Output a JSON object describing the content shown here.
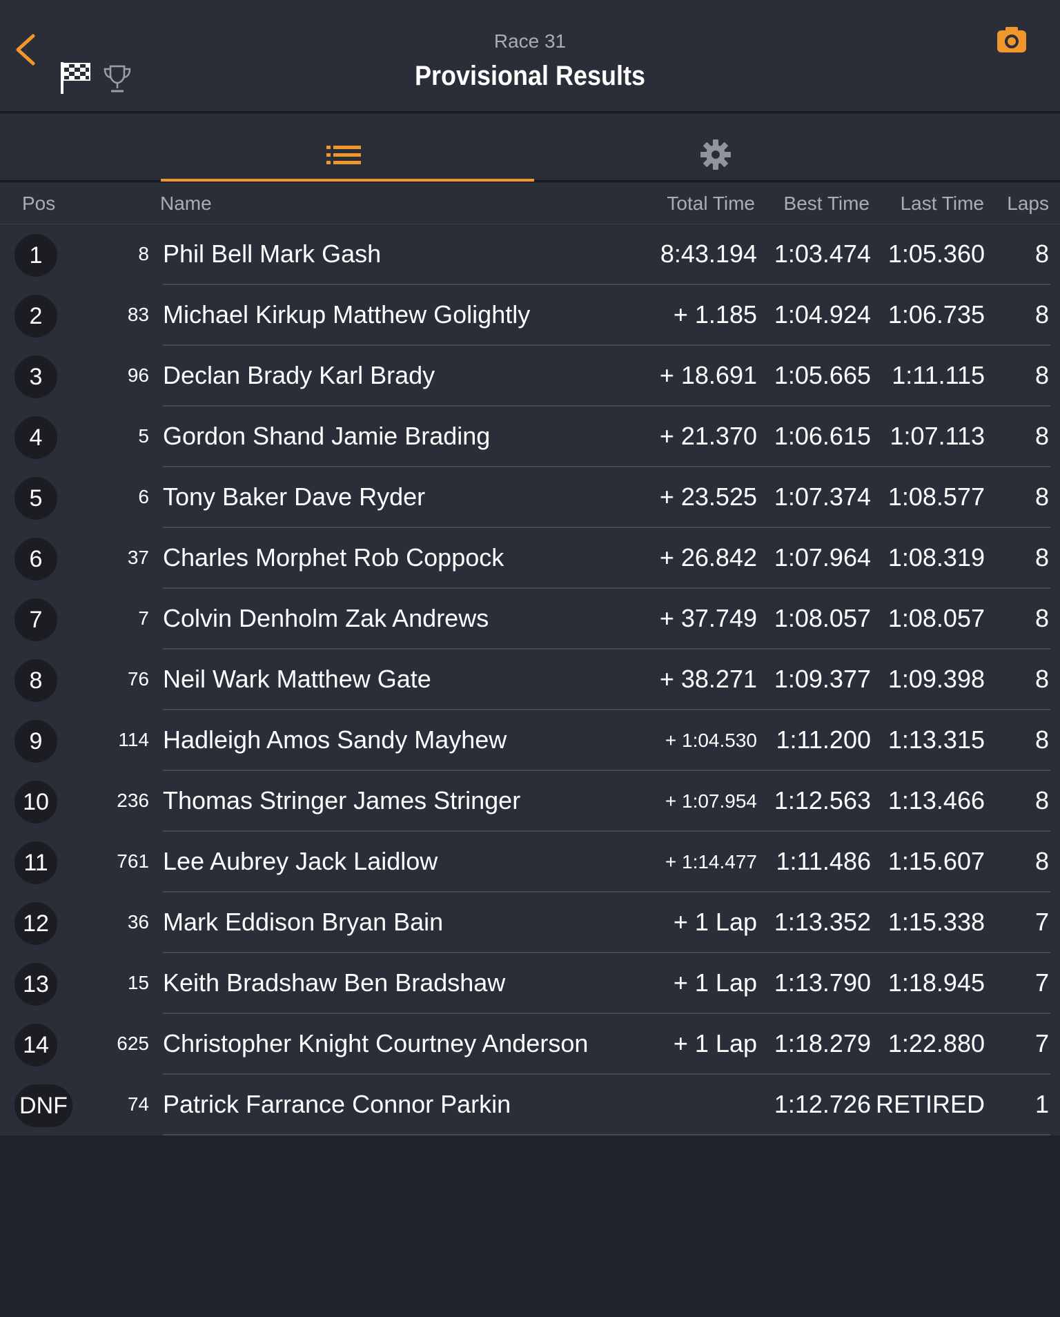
{
  "header": {
    "race_label": "Race 31",
    "title": "Provisional Results",
    "accent_color": "#f0962a",
    "icons": [
      "back-chevron-icon",
      "checkered-flag-icon",
      "trophy-icon",
      "camera-icon"
    ]
  },
  "tabs": [
    {
      "name": "results-list",
      "icon": "list-icon",
      "selected": true
    },
    {
      "name": "settings",
      "icon": "gear-icon",
      "selected": false
    }
  ],
  "columns": {
    "pos": "Pos",
    "name": "Name",
    "total": "Total Time",
    "best": "Best Time",
    "last": "Last Time",
    "laps": "Laps"
  },
  "results": [
    {
      "pos": "1",
      "num": "8",
      "name": "Phil Bell Mark Gash",
      "total": "8:43.194",
      "best": "1:03.474",
      "last": "1:05.360",
      "laps": "8"
    },
    {
      "pos": "2",
      "num": "83",
      "name": "Michael Kirkup Matthew Golightly",
      "total": "+ 1.185",
      "best": "1:04.924",
      "last": "1:06.735",
      "laps": "8"
    },
    {
      "pos": "3",
      "num": "96",
      "name": "Declan Brady Karl Brady",
      "total": "+ 18.691",
      "best": "1:05.665",
      "last": "1:11.115",
      "laps": "8"
    },
    {
      "pos": "4",
      "num": "5",
      "name": "Gordon Shand Jamie Brading",
      "total": "+ 21.370",
      "best": "1:06.615",
      "last": "1:07.113",
      "laps": "8"
    },
    {
      "pos": "5",
      "num": "6",
      "name": "Tony Baker Dave Ryder",
      "total": "+ 23.525",
      "best": "1:07.374",
      "last": "1:08.577",
      "laps": "8"
    },
    {
      "pos": "6",
      "num": "37",
      "name": "Charles Morphet Rob Coppock",
      "total": "+ 26.842",
      "best": "1:07.964",
      "last": "1:08.319",
      "laps": "8"
    },
    {
      "pos": "7",
      "num": "7",
      "name": "Colvin Denholm Zak Andrews",
      "total": "+ 37.749",
      "best": "1:08.057",
      "last": "1:08.057",
      "laps": "8"
    },
    {
      "pos": "8",
      "num": "76",
      "name": "Neil Wark Matthew Gate",
      "total": "+ 38.271",
      "best": "1:09.377",
      "last": "1:09.398",
      "laps": "8"
    },
    {
      "pos": "9",
      "num": "114",
      "name": "Hadleigh Amos Sandy Mayhew",
      "total": "+ 1:04.530",
      "best": "1:11.200",
      "last": "1:13.315",
      "laps": "8"
    },
    {
      "pos": "10",
      "num": "236",
      "name": "Thomas Stringer James Stringer",
      "total": "+ 1:07.954",
      "best": "1:12.563",
      "last": "1:13.466",
      "laps": "8"
    },
    {
      "pos": "11",
      "num": "761",
      "name": "Lee Aubrey Jack Laidlow",
      "total": "+ 1:14.477",
      "best": "1:11.486",
      "last": "1:15.607",
      "laps": "8"
    },
    {
      "pos": "12",
      "num": "36",
      "name": "Mark Eddison Bryan Bain",
      "total": "+ 1 Lap",
      "best": "1:13.352",
      "last": "1:15.338",
      "laps": "7"
    },
    {
      "pos": "13",
      "num": "15",
      "name": "Keith Bradshaw Ben Bradshaw",
      "total": "+ 1 Lap",
      "best": "1:13.790",
      "last": "1:18.945",
      "laps": "7"
    },
    {
      "pos": "14",
      "num": "625",
      "name": "Christopher Knight Courtney Anderson",
      "total": "+ 1 Lap",
      "best": "1:18.279",
      "last": "1:22.880",
      "laps": "7"
    },
    {
      "pos": "DNF",
      "num": "74",
      "name": "Patrick Farrance Connor Parkin",
      "total": "",
      "best": "1:12.726",
      "last": "RETIRED",
      "laps": "1"
    }
  ]
}
